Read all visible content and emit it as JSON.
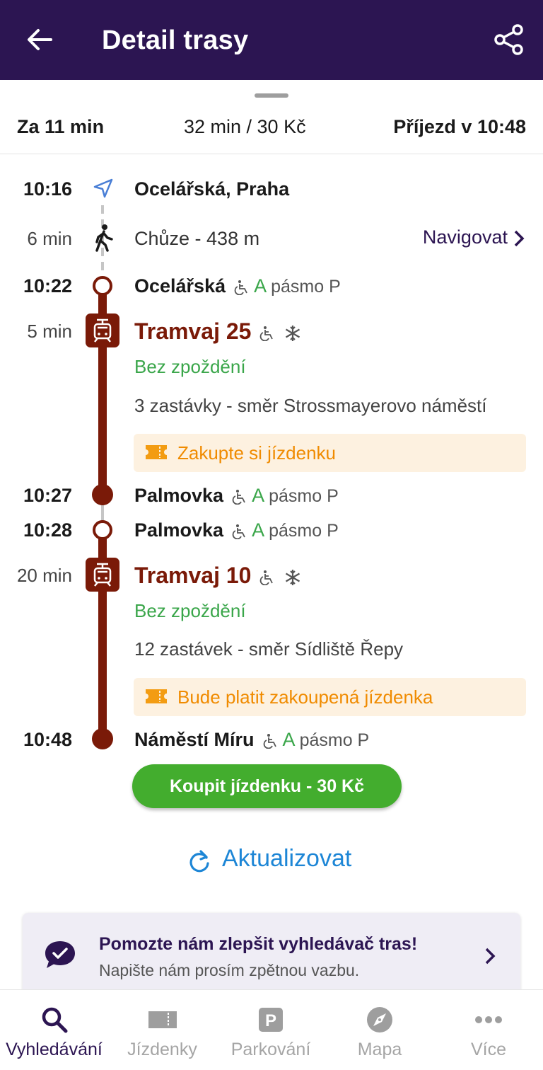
{
  "header": {
    "title": "Detail trasy"
  },
  "summary": {
    "departs_in": "Za 11 min",
    "duration_price": "32 min / 30 Kč",
    "arrival": "Příjezd v 10:48"
  },
  "colors": {
    "appbar": "#2c1552",
    "tram": "#7a1a08",
    "ontime": "#3aa64a",
    "ticket_text": "#f08b00",
    "ticket_bg": "#fdf1e0",
    "buy_button": "#43ad2e",
    "refresh": "#1d86d6"
  },
  "route": {
    "start": {
      "time": "10:16",
      "name": "Ocelářská, Praha",
      "icon": "location-arrow-icon"
    },
    "walk": {
      "duration": "6 min",
      "text": "Chůze - 438 m",
      "navigate_label": "Navigovat",
      "icon": "walking-person-icon"
    },
    "stops": [
      {
        "time": "10:22",
        "name": "Ocelářská",
        "zone_a": "A",
        "zone_p": "pásmo P"
      },
      {
        "time": "10:27",
        "name": "Palmovka",
        "zone_a": "A",
        "zone_p": "pásmo P"
      },
      {
        "time": "10:28",
        "name": "Palmovka",
        "zone_a": "A",
        "zone_p": "pásmo P"
      },
      {
        "time": "10:48",
        "name": "Náměstí Míru",
        "zone_a": "A",
        "zone_p": "pásmo P"
      }
    ],
    "legs": [
      {
        "duration": "5 min",
        "line": "Tramvaj 25",
        "status": "Bez zpoždění",
        "stops_text": "3 zastávky - směr Strossmayerovo náměstí",
        "ticket_text": "Zakupte si jízdenku"
      },
      {
        "duration": "20 min",
        "line": "Tramvaj 10",
        "status": "Bez zpoždění",
        "stops_text": "12 zastávek - směr Sídliště Řepy",
        "ticket_text": "Bude platit zakoupená jízdenka"
      }
    ]
  },
  "buy_button_label": "Koupit jízdenku - 30 Kč",
  "refresh_label": "Aktualizovat",
  "feedback": {
    "title": "Pomozte nám zlepšit vyhledávač tras!",
    "subtitle": "Napište nám prosím zpětnou vazbu."
  },
  "bottom_nav": [
    {
      "label": "Vyhledávání",
      "icon": "search-icon",
      "active": true
    },
    {
      "label": "Jízdenky",
      "icon": "ticket-icon",
      "active": false
    },
    {
      "label": "Parkování",
      "icon": "parking-icon",
      "active": false
    },
    {
      "label": "Mapa",
      "icon": "compass-icon",
      "active": false
    },
    {
      "label": "Více",
      "icon": "more-dots-icon",
      "active": false
    }
  ]
}
